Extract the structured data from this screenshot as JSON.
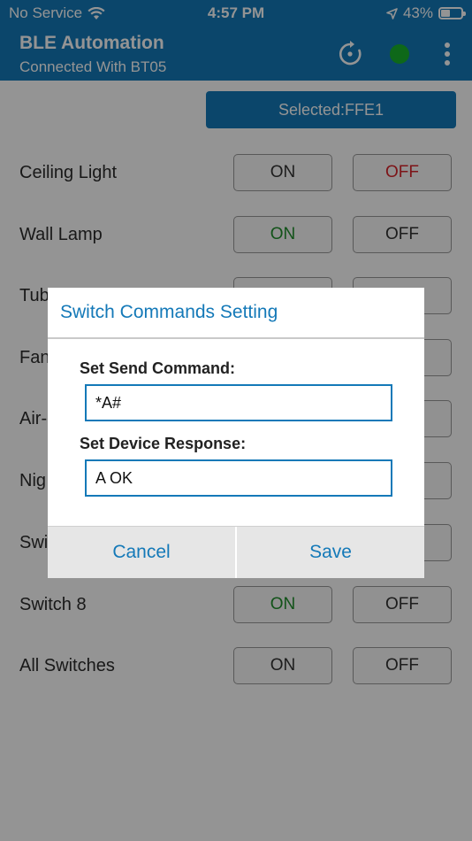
{
  "status_bar": {
    "carrier": "No Service",
    "time": "4:57 PM",
    "battery": "43%",
    "battery_level": 0.43,
    "icons": [
      "wifi-icon",
      "location-arrow-icon",
      "battery-icon"
    ]
  },
  "app_bar": {
    "title": "BLE Automation",
    "subtitle": "Connected With BT05",
    "connection_color": "#19b42b",
    "icons": [
      "refresh-icon",
      "status-dot",
      "more-vert-icon"
    ]
  },
  "selected_button": "Selected:FFE1",
  "switches": [
    {
      "label": "Ceiling Light",
      "on": "ON",
      "off": "OFF",
      "active": "off"
    },
    {
      "label": "Wall Lamp",
      "on": "ON",
      "off": "OFF",
      "active": "on"
    },
    {
      "label": "Tub",
      "on": "",
      "off": "",
      "active": "none"
    },
    {
      "label": "Fan",
      "on": "",
      "off": "",
      "active": "none"
    },
    {
      "label": "Air-",
      "on": "",
      "off": "",
      "active": "none"
    },
    {
      "label": "Nig",
      "on": "",
      "off": "",
      "active": "none"
    },
    {
      "label": "Swi",
      "on": "",
      "off": "",
      "active": "none"
    },
    {
      "label": "Switch 8",
      "on": "ON",
      "off": "OFF",
      "active": "on"
    },
    {
      "label": "All Switches",
      "on": "ON",
      "off": "OFF",
      "active": "none"
    }
  ],
  "dialog": {
    "title": "Switch Commands Setting",
    "send_label": "Set Send Command:",
    "send_value": "*A#",
    "response_label": "Set Device Response:",
    "response_value": "A OK",
    "cancel": "Cancel",
    "save": "Save"
  },
  "colors": {
    "primary": "#1479b8",
    "on_green": "#1f8f2c",
    "off_red": "#d8232a"
  }
}
